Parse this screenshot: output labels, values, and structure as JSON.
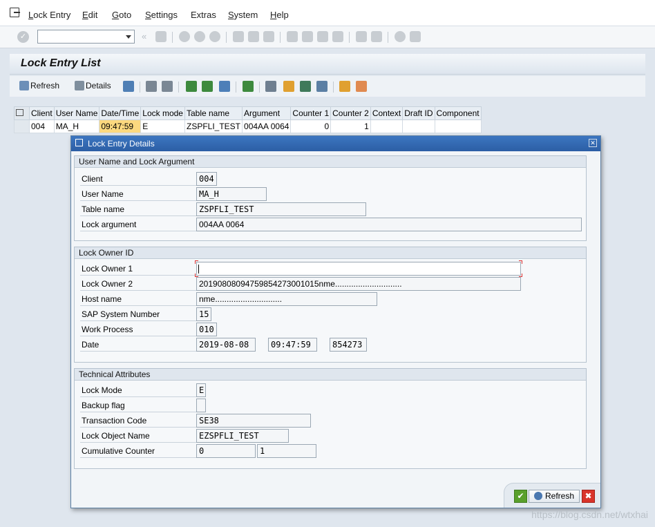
{
  "menu": {
    "items": [
      {
        "label": "Lock Entry",
        "underline": "L",
        "rest": "ock Entry"
      },
      {
        "label": "Edit",
        "underline": "E",
        "rest": "dit"
      },
      {
        "label": "Goto",
        "underline": "G",
        "rest": "oto"
      },
      {
        "label": "Settings",
        "underline": "S",
        "rest": "ettings"
      },
      {
        "label": "Extras",
        "underline": "",
        "rest": "Extras"
      },
      {
        "label": "System",
        "underline": "S",
        "rest": "ystem"
      },
      {
        "label": "Help",
        "underline": "H",
        "rest": "elp"
      }
    ]
  },
  "page_title": "Lock Entry List",
  "app_toolbar": {
    "refresh_label": "Refresh",
    "details_label": "Details"
  },
  "grid": {
    "headers": [
      "Client",
      "User Name",
      "Date/Time",
      "Lock mode",
      "Table name",
      "Argument",
      "Counter 1",
      "Counter 2",
      "Context",
      "Draft ID",
      "Component"
    ],
    "row": [
      "004",
      "MA_H",
      "09:47:59",
      "E",
      "ZSPFLI_TEST",
      "004AA 0064",
      "0",
      "1",
      "",
      "",
      ""
    ]
  },
  "dialog": {
    "title": "Lock Entry Details",
    "group1": {
      "header": "User Name and Lock Argument",
      "client_label": "Client",
      "client": "004",
      "user_label": "User Name",
      "user": "MA_H",
      "table_label": "Table name",
      "table": "ZSPFLI_TEST",
      "arg_label": "Lock argument",
      "arg": "004AA 0064"
    },
    "group2": {
      "header": "Lock Owner ID",
      "owner1_label": "Lock Owner 1",
      "owner1": "",
      "owner2_label": "Lock Owner 2",
      "owner2": "20190808094759854273001015nme.............................",
      "host_label": "Host name",
      "host": "nme.............................",
      "sysnr_label": "SAP System Number",
      "sysnr": "15",
      "wp_label": "Work Process",
      "wp": "010",
      "date_label": "Date",
      "date": "2019-08-08",
      "time": "09:47:59",
      "micro": "854273"
    },
    "group3": {
      "header": "Technical Attributes",
      "mode_label": "Lock Mode",
      "mode": "E",
      "backup_label": "Backup flag",
      "backup": "",
      "tcode_label": "Transaction Code",
      "tcode": "SE38",
      "objname_label": "Lock Object Name",
      "objname": "EZSPFLI_TEST",
      "cum_label": "Cumulative Counter",
      "cum1": "0",
      "cum2": "1"
    },
    "footer": {
      "refresh_label": "Refresh"
    }
  },
  "watermark": "https://blog.csdn.net/wtxhai",
  "colors": {
    "dialog_title": "#2c5ea5",
    "highlight_cell": "#fcd97f",
    "cancel": "#d9342b",
    "confirm": "#5aa02c"
  }
}
